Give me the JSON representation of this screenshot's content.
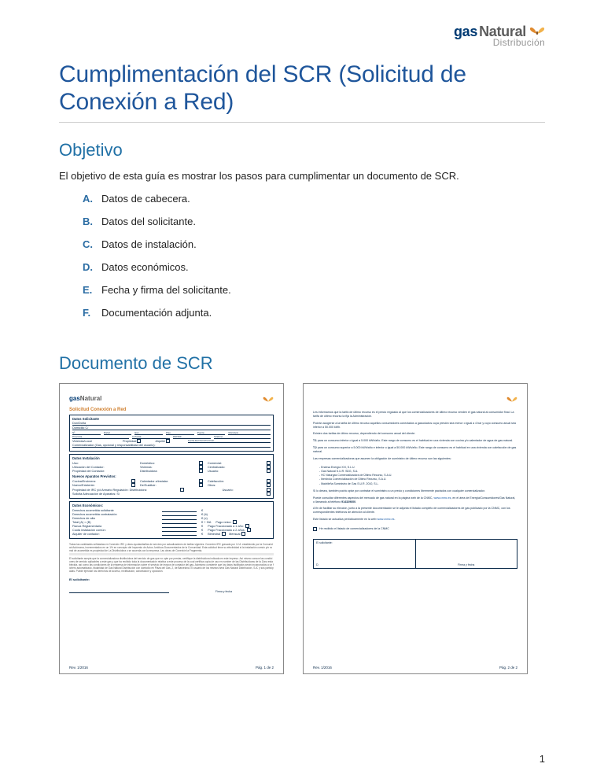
{
  "brand": {
    "gas": "gas",
    "natural": "Natural",
    "distribucion": "Distribución"
  },
  "title": "Cumplimentación del SCR (Solicitud de Conexión a Red)",
  "objective": {
    "heading": "Objetivo",
    "intro": "El objetivo de esta guía es mostrar los pasos para cumplimentar un documento de SCR.",
    "items": [
      {
        "letter": "A.",
        "text": "Datos de cabecera."
      },
      {
        "letter": "B.",
        "text": "Datos del solicitante."
      },
      {
        "letter": "C.",
        "text": "Datos de instalación."
      },
      {
        "letter": "D.",
        "text": "Datos económicos."
      },
      {
        "letter": "E.",
        "text": "Fecha y firma del solicitante."
      },
      {
        "letter": "F.",
        "text": "Documentación adjunta."
      }
    ]
  },
  "doc_section_heading": "Documento de SCR",
  "thumb1": {
    "scr_title": "Solicitud Conexión a Red",
    "box_solicitante": "Datos Solicitante",
    "fields_row2_a": "Nº",
    "fields_row2_b": "Portal",
    "fields_row2_c": "Esc.",
    "fields_row2_d": "Piso",
    "fields_row2_e": "Puerta",
    "fields_row2_f": "Municipio",
    "fields_row3_a": "Provincia",
    "fields_row3_b": "C.Postal",
    "fields_row3_c": "DNI/NIF",
    "fields_row3_d": "Teléfono",
    "row4a": "Vivienda/Local",
    "row4b": "Propiedad",
    "row4c": "Alquiler",
    "row4d": "Fecha Escritura/Contrato",
    "row5": "Comercializador (Gas, opcional y responsabilidad del usuario):",
    "box_instalacion": "Datos Instalación",
    "inst_l1": "Uso:",
    "inst_r1": "Doméstico:",
    "inst_r1b": "Comercial:",
    "inst_l2": "Ubicación del Contador:",
    "inst_r2": "Vivienda:",
    "inst_r2b": "Centralizado:",
    "inst_l3": "Propiedad del Contador:",
    "inst_r3": "Distribuidora:",
    "inst_r3b": "Usuario:",
    "inst_l4": "Nuevos Aparatos Previstos:",
    "inst_l5": "Cocina/Encimera:",
    "inst_r5": "Calentador a/instalar:",
    "inst_r5b": "Calefacción:",
    "inst_l6": "Nuevo/Existente:",
    "inst_r6": "De/Sustituir:",
    "inst_r6b": "Otros:",
    "inst_l7": "Propiedad de IRC y/ó Armario Regulación: Distribuidora:",
    "inst_r7": "Usuario:",
    "inst_l8": "Solicita Adecuación de Aparatos: Sí",
    "box_econ": "Datos Económicos:",
    "e1": "Derechos acometida solicitante",
    "e1v": "€",
    "e2": "Derechos acometida contratación",
    "e2v": "€   (b)",
    "e3": "Derechos de alta",
    "e3v": "€   (c)",
    "e4": "Total (A) = (B)",
    "e4v": "€  + IVA",
    "e5": "Fianza Reglamentaria",
    "e5v": "€",
    "e6": "Cuota instalación común:",
    "e6v": "€",
    "e7": "Alquiler de contador:",
    "e7v": "€",
    "pay1": "Pago único:",
    "pay2": "Pago Fraccionado a 1 año:",
    "pay3": "Pago Fraccionado a 2 años:",
    "period": "Bimestral",
    "period2": "Mensual",
    "sig_left": "El solicitante:",
    "sig_right": "Firma y fecha",
    "footer_left": "Rev. 1/2016",
    "footer_right": "Pág. 1 de 2"
  },
  "thumb2": {
    "p1": "Les informamos que la tarifa de último recurso es el precio regulado al que los comercializadores de último recurso venden el gas natural al consumidor final. La tarifa de último recurso la fija la Administración.",
    "p2": "Podrán acogerse a la tarifa de último recurso aquellos consumidores conectados a gasoductos cuya presión sea menor o igual a 4 bar y cuyo consumo anual sea inferior a 50.000 kWh.",
    "p3": "Existen dos tarifas de último recurso, dependiendo del consumo anual del cliente:",
    "t1b": "T.1",
    "t1": "para un consumo inferior o igual a 5.000 kWh/año. Este rango de consumo es el habitual en una vivienda con cocina y/o calentador de agua de gas natural.",
    "t2b": "T.2",
    "t2": "para un consumo superior a 5.000 kWh/año e inferior o igual a 50.000 kWh/año. Este rango de consumo es el habitual en una vivienda con calefacción de gas natural.",
    "p4": "Las empresas comercializadoras que asumen la obligación de suministro de último recurso son las siguientes:",
    "bul1": "Endesa Energía XXI, S.L.U.",
    "bul2": "Gas Natural S.U.R. SDG, S.A.",
    "bul3": "HC Naturgas Comercializadora de Último Recurso, S.A.U.",
    "bul4": "Iberdrola Comercialización de Último Recurso, S.A.U.",
    "bul5": "Madrileña Suministro de Gas S.U.R. 2010, S.L.",
    "p5a": "Si lo desea, también podrá optar por contratar el suministro a un precio y condiciones libremente pactados con cualquier comercializador.",
    "p5": "Puede consultar diferentes aspectos del mercado de gas natural en la página web de la CNMC,",
    "link1": "www.cnmc.es",
    "p5b": ", en el área de Energía/Consumidores/Gas Natural, o llamando al teléfono",
    "phone": "914329600",
    "p6": "A fin de facilitar su elección, junto a la presente documentación se le adjunta el listado completo de comercializadores de gas publicado por la CNMC, con los correspondientes teléfonos de atención al cliente.",
    "p7": "Este listado se actualiza periódicamente en la web ",
    "link2": "www.cnmc.es",
    "chk": "He recibido el listado de comercializadores de la CNMC",
    "sig_left": "El solicitante:",
    "sig_d": "D.",
    "sig_right": "Firma y fecha",
    "footer_left": "Rev. 1/2016",
    "footer_right": "Pág. 2 de 2"
  },
  "page_number": "1"
}
